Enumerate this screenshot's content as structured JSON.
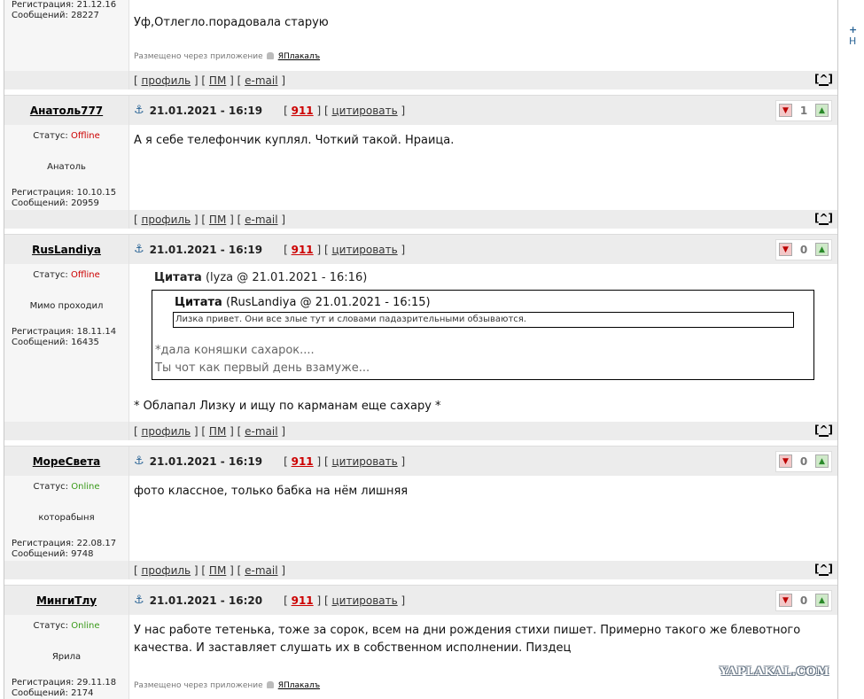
{
  "common": {
    "anchor_icon": "anchor-icon",
    "post_id_label": "911",
    "quote_label": "цитировать",
    "profile_label": "профиль",
    "pm_label": "ПМ",
    "email_label": "e-mail",
    "top_label": "^",
    "status_prefix": "Статус:",
    "reg_prefix": "Регистрация:",
    "msgs_prefix": "Сообщений:",
    "via_text": "Размещено через приложение",
    "via_app": "ЯПлакалъ",
    "colors": {
      "offline": "#cc0000",
      "online": "#3a9a1a",
      "post_number": "#cc0000"
    }
  },
  "posts": [
    {
      "reg_date": "21.12.16",
      "messages": "28227",
      "text": "Уф,Отлегло.порадовала старую"
    },
    {
      "author": "Анатоль777",
      "date": "21.01.2021 - 16:19",
      "rating": "1",
      "status": "Offline",
      "nickname": "Анатоль",
      "reg_date": "10.10.15",
      "messages": "20959",
      "text": "А я себе телефончик куплял. Чоткий такой. Нраица."
    },
    {
      "author": "RusLandiya",
      "date": "21.01.2021 - 16:19",
      "rating": "0",
      "status": "Offline",
      "nickname": "Мимо проходил",
      "reg_date": "18.11.14",
      "messages": "16435",
      "quote": {
        "label": "Цитата",
        "meta": "(lyza @ 21.01.2021 - 16:16)",
        "inner_label": "Цитата",
        "inner_meta": "(RusLandiya @ 21.01.2021 - 16:15)",
        "inner_text": "Лизка привет. Они все злые тут и словами падазрительными обзываются.",
        "line1": "*дала коняшки сахарок....",
        "line2": "Ты чот как первый день взамуже..."
      },
      "text": "* Облапал Лизку и ищу по карманам еще сахару *"
    },
    {
      "author": "МореСвета",
      "date": "21.01.2021 - 16:19",
      "rating": "0",
      "status": "Online",
      "nickname": "которабыня",
      "reg_date": "22.08.17",
      "messages": "9748",
      "text": "фото классное, только бабка на нём лишняя"
    },
    {
      "author": "МингиТлу",
      "date": "21.01.2021 - 16:20",
      "rating": "0",
      "status": "Online",
      "nickname": "Ярила",
      "reg_date": "29.11.18",
      "messages": "2174",
      "text": "У нас работе тетенька, тоже за сорок, всем на дни рождения стихи пишет. Примерно такого же блевотного качества. И заставляет слушать их в собственном исполнении. Пиздец"
    }
  ],
  "sidebar": {
    "text": "Н"
  },
  "watermark": "YAPLAKAL.COM"
}
